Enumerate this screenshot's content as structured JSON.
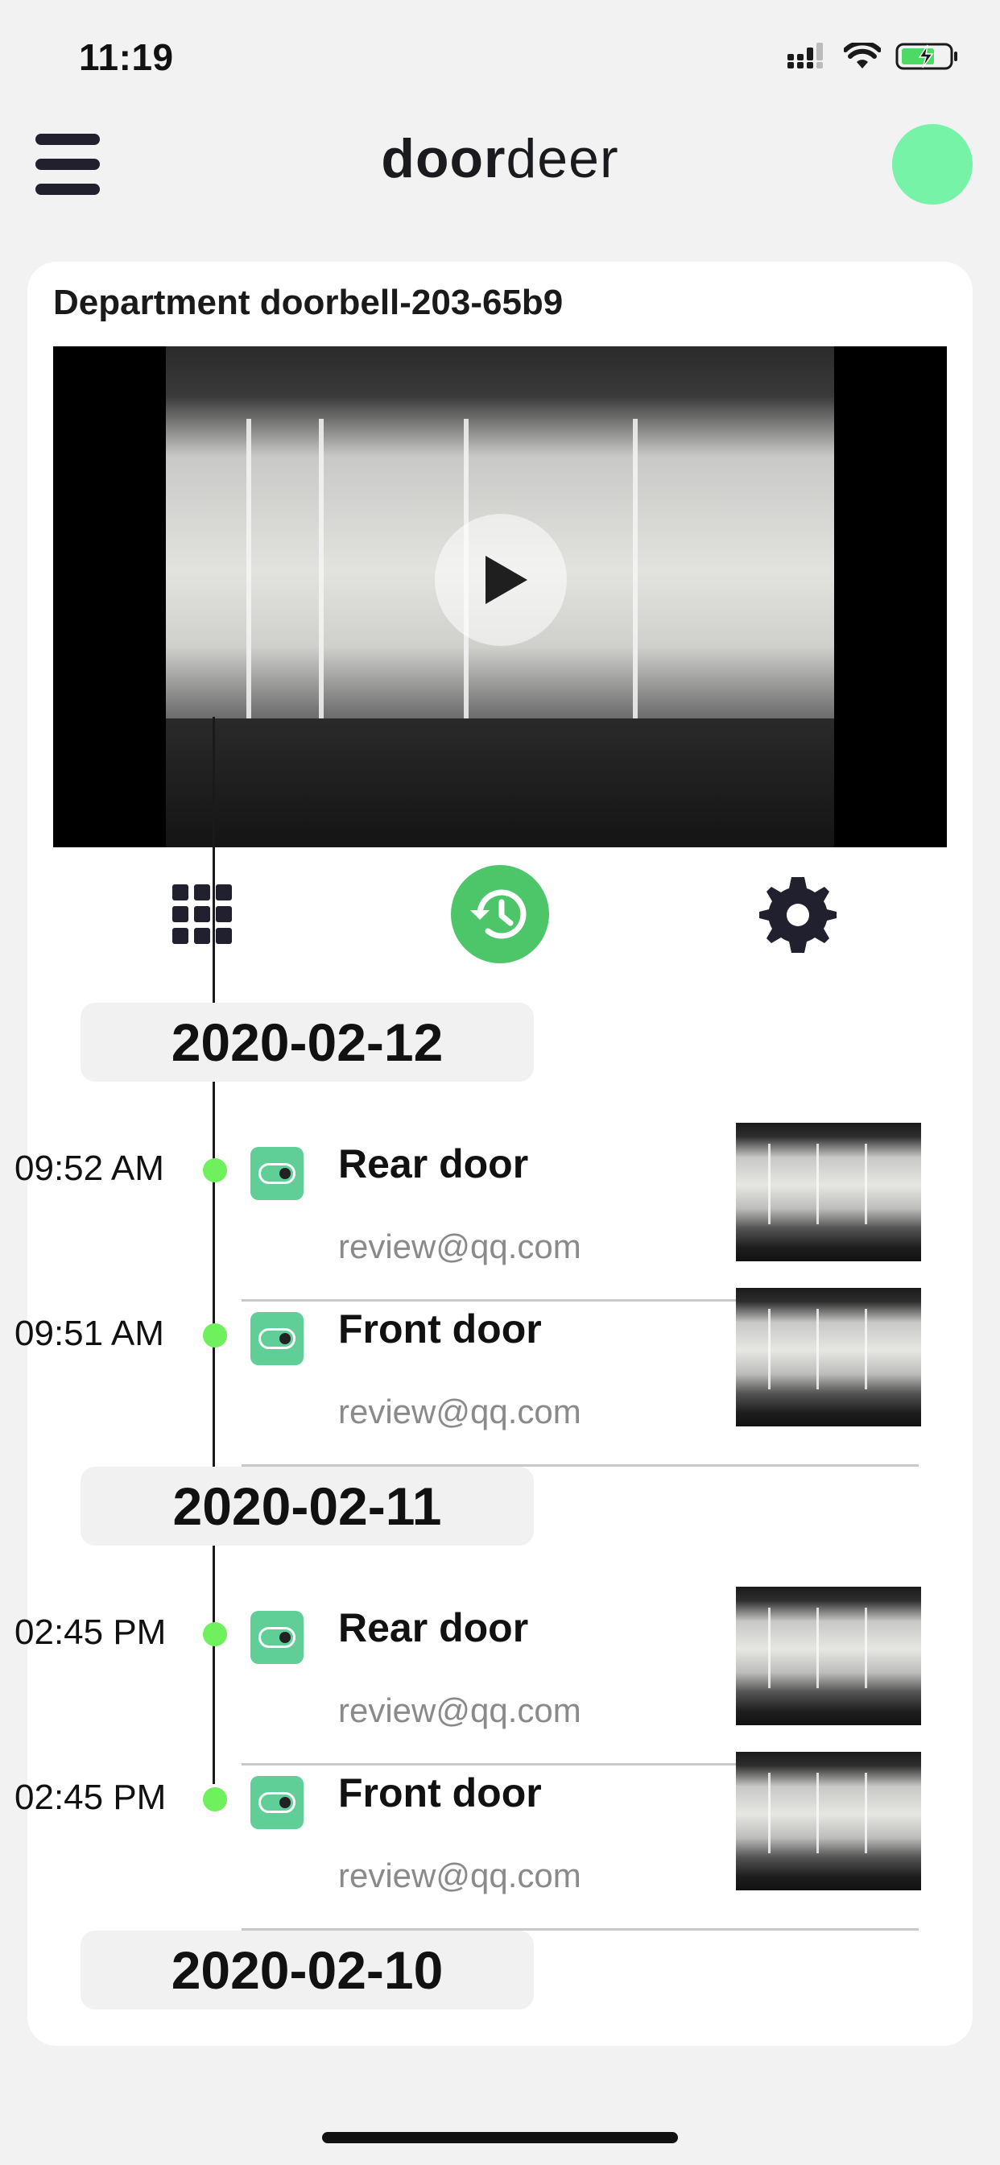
{
  "status_bar": {
    "time": "11:19"
  },
  "header": {
    "logo_bold": "door",
    "logo_light": "deer",
    "colors": {
      "avatar": "#76f3a6"
    }
  },
  "device": {
    "title": "Department doorbell-203-65b9"
  },
  "tabs": [
    {
      "icon": "grid-icon",
      "active": false
    },
    {
      "icon": "history-icon",
      "active": true
    },
    {
      "icon": "gear-icon",
      "active": false
    }
  ],
  "timeline": {
    "dates": [
      "2020-02-12",
      "2020-02-11",
      "2020-02-10"
    ],
    "events": [
      {
        "time": "09:52 AM",
        "name": "Rear door",
        "user": "review@qq.com"
      },
      {
        "time": "09:51 AM",
        "name": "Front door",
        "user": "review@qq.com"
      },
      {
        "time": "02:45 PM",
        "name": "Rear door",
        "user": "review@qq.com"
      },
      {
        "time": "02:45 PM",
        "name": "Front door",
        "user": "review@qq.com"
      }
    ]
  },
  "colors": {
    "accent": "#4dc66a",
    "event_icon": "#5fcf97",
    "timeline_dot": "#6ef15c"
  }
}
